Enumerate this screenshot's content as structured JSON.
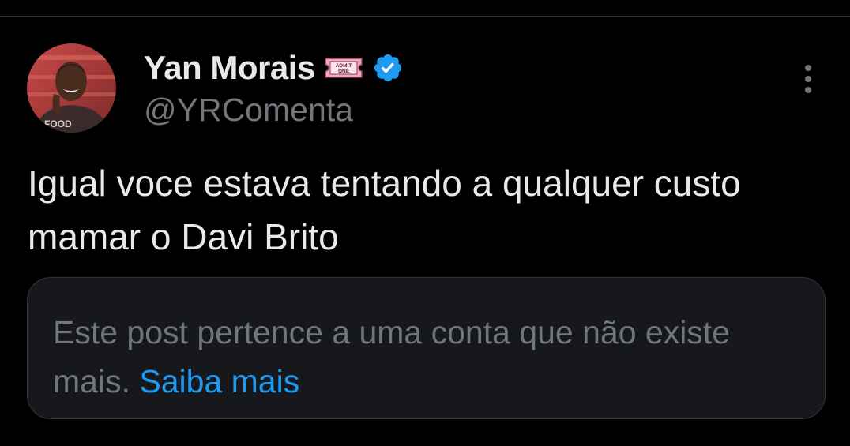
{
  "author": {
    "display_name": "Yan Morais",
    "handle": "@YRComenta",
    "badges": [
      "admit-one-ticket-emoji",
      "verified-badge-icon"
    ],
    "ticket_text_top": "ADMIT",
    "ticket_text_bottom": "ONE",
    "shirt_text": "FOOD"
  },
  "tweet": {
    "text": "Igual voce estava tentando a qualquer custo mamar o Davi Brito"
  },
  "notice": {
    "text": "Este post pertence a uma conta que não existe mais.",
    "link_label": "Saiba mais"
  },
  "icons": {
    "more": "more-options-icon"
  },
  "colors": {
    "background": "#000000",
    "primary_text": "#e7e9ea",
    "secondary_text": "#71767b",
    "link": "#1d9bf0",
    "verified": "#1d9bf0",
    "card_background": "#16181c",
    "divider": "#2f3336"
  }
}
